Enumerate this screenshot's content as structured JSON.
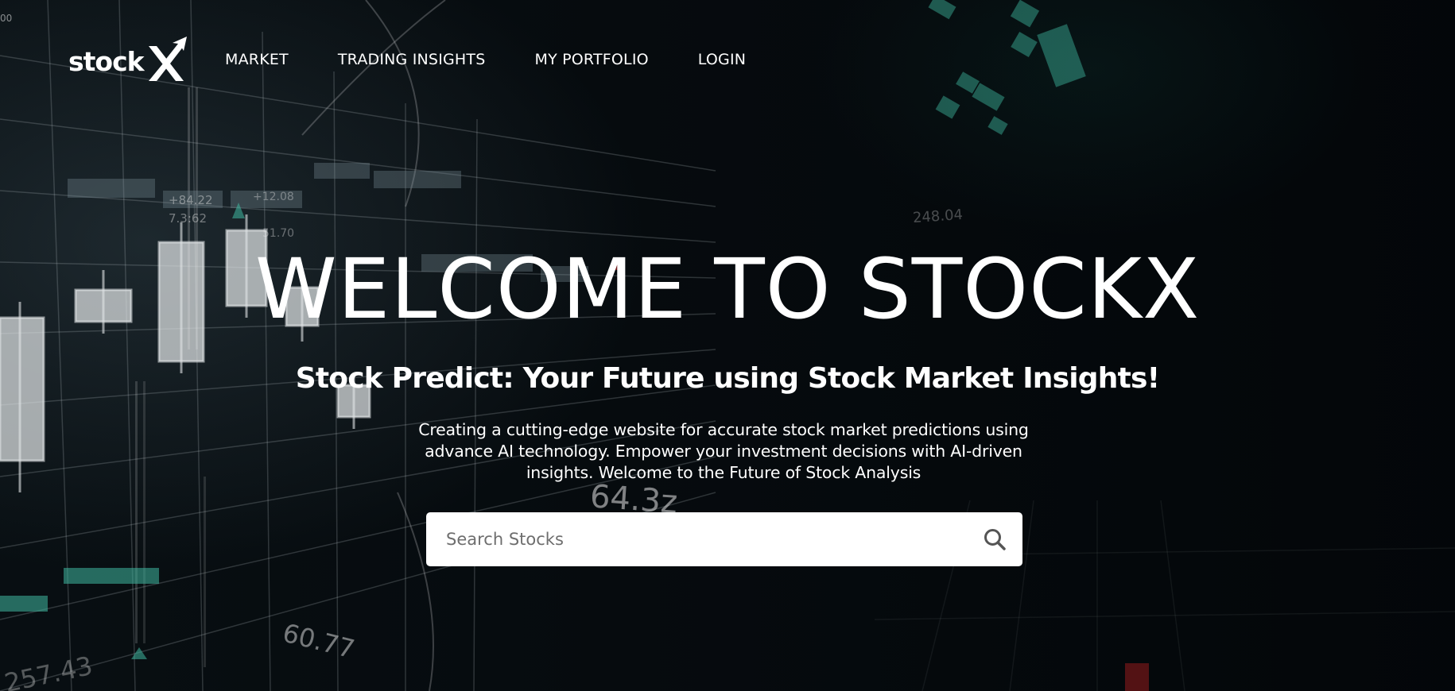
{
  "brand": {
    "logo_text": "stock",
    "name": "StockX"
  },
  "nav": {
    "items": [
      {
        "label": "MARKET"
      },
      {
        "label": "TRADING INSIGHTS"
      },
      {
        "label": "MY PORTFOLIO"
      },
      {
        "label": "LOGIN"
      }
    ]
  },
  "hero": {
    "title": "WELCOME TO STOCKX",
    "subtitle": "Stock Predict: Your Future using Stock Market Insights!",
    "description": "Creating a cutting-edge website for accurate stock market predictions using advance AI technology. Empower your investment decisions with AI-driven insights. Welcome to the Future of Stock Analysis"
  },
  "search": {
    "placeholder": "Search Stocks",
    "value": "",
    "icon": "search-icon"
  },
  "background": {
    "ticker_numbers": [
      "00",
      "64.3z",
      "60.77",
      "257.43",
      "248.04",
      "+84.22",
      "7.3:62",
      "+12.08",
      "51.70"
    ]
  },
  "colors": {
    "background": "#05090c",
    "text": "#ffffff",
    "search_bg": "#ffffff",
    "placeholder": "#6e6e6e",
    "accent_teal": "#3fb8a0"
  }
}
